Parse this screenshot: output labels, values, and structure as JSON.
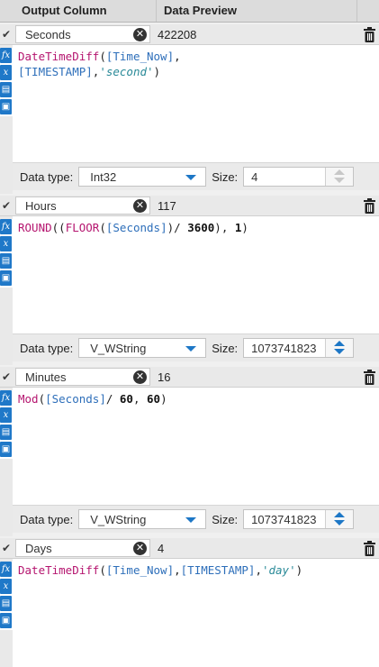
{
  "header": {
    "col_output": "Output Column",
    "col_preview": "Data Preview"
  },
  "labels": {
    "data_type": "Data type:",
    "size": "Size:"
  },
  "icons": {
    "row_check": "checkmark-icon",
    "clear": "clear-x-icon",
    "delete": "trash-icon",
    "sidebar": [
      "function-fx-icon",
      "variable-x-icon",
      "folder-icon",
      "save-icon"
    ],
    "accent_color": "#1f78c8"
  },
  "formulas": [
    {
      "name": "Seconds",
      "preview": "422208",
      "expression_tokens": [
        {
          "t": "fn",
          "v": "DateTimeDiff"
        },
        {
          "t": "op",
          "v": "("
        },
        {
          "t": "fld",
          "v": "[Time_Now]"
        },
        {
          "t": "op",
          "v": ",\n"
        },
        {
          "t": "fld",
          "v": "[TIMESTAMP]"
        },
        {
          "t": "op",
          "v": ","
        },
        {
          "t": "str",
          "v": "'second'"
        },
        {
          "t": "op",
          "v": ")"
        }
      ],
      "data_type": "Int32",
      "size": "4"
    },
    {
      "name": "Hours",
      "preview": "117",
      "expression_tokens": [
        {
          "t": "fn",
          "v": "ROUND"
        },
        {
          "t": "op",
          "v": "(("
        },
        {
          "t": "fn",
          "v": "FLOOR"
        },
        {
          "t": "op",
          "v": "("
        },
        {
          "t": "fld",
          "v": "[Seconds]"
        },
        {
          "t": "op",
          "v": ")/ "
        },
        {
          "t": "num",
          "v": "3600"
        },
        {
          "t": "op",
          "v": "), "
        },
        {
          "t": "num",
          "v": "1"
        },
        {
          "t": "op",
          "v": ")"
        }
      ],
      "data_type": "V_WString",
      "size": "1073741823"
    },
    {
      "name": "Minutes",
      "preview": "16",
      "expression_tokens": [
        {
          "t": "fn",
          "v": "Mod"
        },
        {
          "t": "op",
          "v": "("
        },
        {
          "t": "fld",
          "v": "[Seconds]"
        },
        {
          "t": "op",
          "v": "/ "
        },
        {
          "t": "num",
          "v": "60"
        },
        {
          "t": "op",
          "v": ", "
        },
        {
          "t": "num",
          "v": "60"
        },
        {
          "t": "op",
          "v": ")"
        }
      ],
      "data_type": "V_WString",
      "size": "1073741823"
    },
    {
      "name": "Days",
      "preview": "4",
      "expression_tokens": [
        {
          "t": "fn",
          "v": "DateTimeDiff"
        },
        {
          "t": "op",
          "v": "("
        },
        {
          "t": "fld",
          "v": "[Time_Now]"
        },
        {
          "t": "op",
          "v": ","
        },
        {
          "t": "fld",
          "v": "[TIMESTAMP]"
        },
        {
          "t": "op",
          "v": ","
        },
        {
          "t": "str",
          "v": "'day'"
        },
        {
          "t": "op",
          "v": ")"
        }
      ]
    }
  ]
}
